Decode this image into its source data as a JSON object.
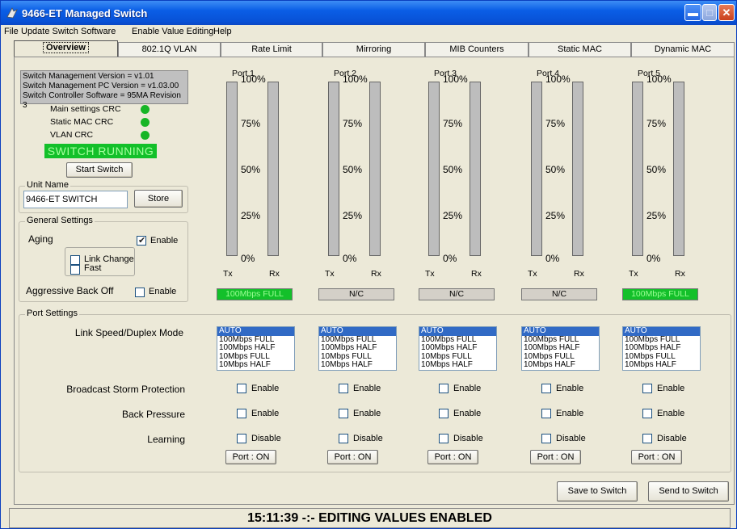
{
  "window": {
    "title": "9466-ET Managed Switch"
  },
  "menu": [
    "File",
    "Update Switch Software",
    "Enable Value Editing",
    "Help"
  ],
  "tabs": [
    "Overview",
    "802.1Q VLAN",
    "Rate Limit",
    "Mirroring",
    "MIB Counters",
    "Static MAC",
    "Dynamic MAC"
  ],
  "info": {
    "lines": [
      "Switch Management Version = v1.01",
      "Switch Management PC Version = v1.03.00",
      "Switch Controller Software = 95MA Revision 3"
    ],
    "crc": [
      "Main settings CRC",
      "Static MAC CRC",
      "VLAN CRC"
    ],
    "running": "SWITCH RUNNING",
    "start_button": "Start Switch"
  },
  "unit_name": {
    "label": "Unit Name",
    "value": "9466-ET SWITCH",
    "store_button": "Store"
  },
  "general": {
    "label": "General Settings",
    "aging_label": "Aging",
    "aging_enable": "Enable",
    "link_change": "Link Change",
    "fast": "Fast",
    "aggressive_label": "Aggressive Back Off",
    "aggressive_enable": "Enable"
  },
  "ports": [
    {
      "name": "Port 1",
      "status": "100Mbps FULL",
      "status_color": "#13c02a"
    },
    {
      "name": "Port 2",
      "status": "N/C",
      "status_color": "#d4d0c8"
    },
    {
      "name": "Port 3",
      "status": "N/C",
      "status_color": "#d4d0c8"
    },
    {
      "name": "Port 4",
      "status": "N/C",
      "status_color": "#d4d0c8"
    },
    {
      "name": "Port 5",
      "status": "100Mbps FULL",
      "status_color": "#13c02a"
    }
  ],
  "bar_scale": [
    "100%",
    "75%",
    "50%",
    "25%",
    "0%"
  ],
  "tx_label": "Tx",
  "rx_label": "Rx",
  "port_settings": {
    "label": "Port Settings",
    "link_speed_label": "Link Speed/Duplex Mode",
    "broadcast_label": "Broadcast Storm Protection",
    "back_pressure_label": "Back Pressure",
    "learning_label": "Learning",
    "speed_options": [
      "AUTO",
      "100Mbps FULL",
      "100Mbps HALF",
      "10Mbps FULL",
      "10Mbps HALF"
    ],
    "selected_speed": "AUTO",
    "enable": "Enable",
    "disable": "Disable",
    "port_button": "Port : ON"
  },
  "buttons": {
    "save": "Save to Switch",
    "send": "Send to Switch"
  },
  "status_bar": "15:11:39 -:- EDITING VALUES ENABLED"
}
